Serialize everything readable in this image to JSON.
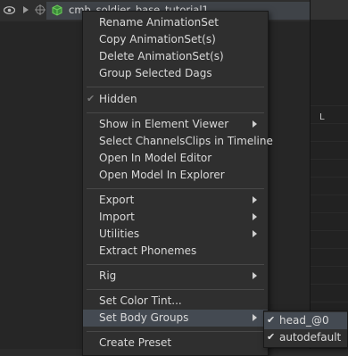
{
  "tree": {
    "label": "cmb_soldier_base_tutorial1"
  },
  "context_menu": {
    "rename": "Rename AnimationSet",
    "copy": "Copy AnimationSet(s)",
    "delete": "Delete AnimationSet(s)",
    "group": "Group Selected Dags",
    "hidden": "Hidden",
    "show_in_element_viewer": "Show in Element Viewer",
    "select_channels": "Select ChannelsClips in Timeline",
    "open_model_editor": "Open In Model Editor",
    "open_model_explorer": "Open Model In Explorer",
    "export": "Export",
    "import": "Import",
    "utilities": "Utilities",
    "extract_phonemes": "Extract Phonemes",
    "rig": "Rig",
    "set_color_tint": "Set Color Tint...",
    "set_body_groups": "Set Body Groups",
    "create_preset": "Create Preset"
  },
  "body_groups_submenu": {
    "items": [
      {
        "label": "head_@0",
        "checked": true
      },
      {
        "label": "autodefault",
        "checked": true
      }
    ]
  },
  "sidebar": {
    "marker": "L"
  },
  "colors": {
    "menu_bg": "#2f2f2f",
    "highlight": "#444a52",
    "text": "#d9d9d9",
    "visible_eye_green": "#5fb04a"
  }
}
